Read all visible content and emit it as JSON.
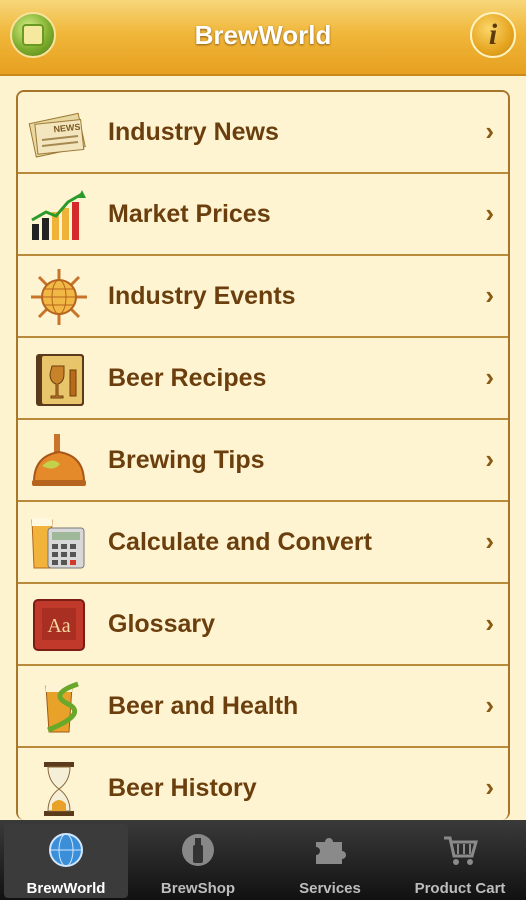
{
  "header": {
    "title": "BrewWorld",
    "info_icon": "info-icon",
    "logo": "brewworld-logo"
  },
  "menu": [
    {
      "label": "Industry News",
      "icon": "newspaper-icon"
    },
    {
      "label": "Market Prices",
      "icon": "bar-chart-icon"
    },
    {
      "label": "Industry Events",
      "icon": "globe-sun-icon"
    },
    {
      "label": "Beer Recipes",
      "icon": "recipe-book-icon"
    },
    {
      "label": "Brewing Tips",
      "icon": "brew-kettle-icon"
    },
    {
      "label": "Calculate and Convert",
      "icon": "calculator-icon"
    },
    {
      "label": "Glossary",
      "icon": "dictionary-icon"
    },
    {
      "label": "Beer and Health",
      "icon": "beer-health-icon"
    },
    {
      "label": "Beer History",
      "icon": "hourglass-icon"
    }
  ],
  "tabs": [
    {
      "label": "BrewWorld",
      "icon": "globe-icon",
      "active": true
    },
    {
      "label": "BrewShop",
      "icon": "bottle-icon",
      "active": false
    },
    {
      "label": "Services",
      "icon": "puzzle-icon",
      "active": false
    },
    {
      "label": "Product Cart",
      "icon": "cart-icon",
      "active": false
    }
  ],
  "colors": {
    "header": "#f0b73a",
    "text": "#6b3f0d",
    "background": "#fdf3cf",
    "tabbar": "#1a1a1a"
  },
  "chevron": "›"
}
